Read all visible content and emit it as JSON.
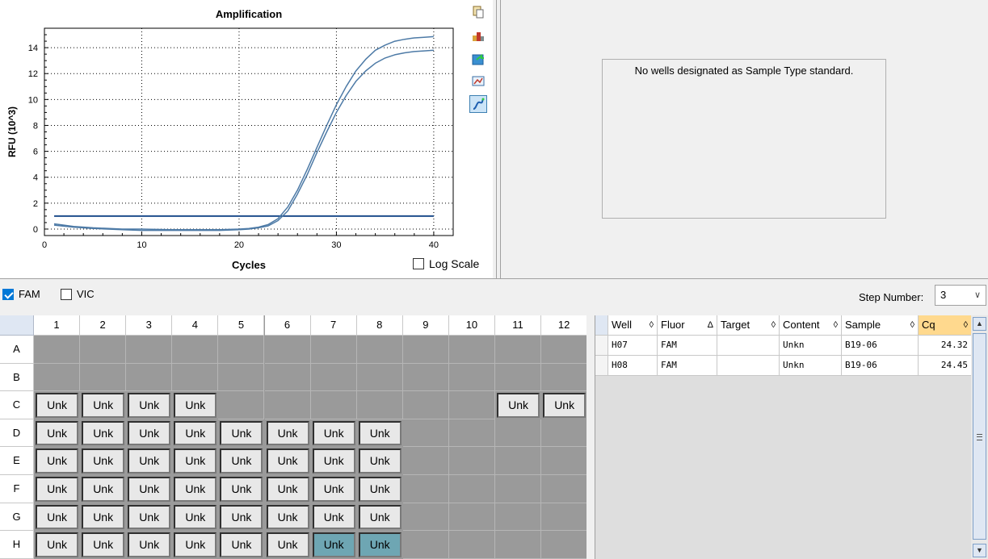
{
  "chart_data": {
    "type": "line",
    "title": "Amplification",
    "xlabel": "Cycles",
    "ylabel": "RFU (10^3)",
    "xlim": [
      0,
      42
    ],
    "ylim": [
      -0.5,
      15.5
    ],
    "x_ticks": [
      0,
      10,
      20,
      30,
      40
    ],
    "y_ticks": [
      0,
      2,
      4,
      6,
      8,
      10,
      12,
      14
    ],
    "grid": true,
    "grid_style": "dotted",
    "threshold": 1.0,
    "series": [
      {
        "x": [
          1,
          3,
          5,
          8,
          10,
          13,
          15,
          18,
          20,
          21,
          22,
          23,
          24,
          25,
          26,
          27,
          28,
          29,
          30,
          31,
          32,
          33,
          34,
          35,
          36,
          37,
          38,
          39,
          40
        ],
        "values": [
          0.4,
          0.2,
          0.1,
          0.0,
          0.0,
          -0.05,
          -0.05,
          -0.05,
          0.0,
          0.05,
          0.15,
          0.35,
          0.8,
          1.7,
          3.0,
          4.6,
          6.3,
          8.0,
          9.6,
          11.0,
          12.2,
          13.1,
          13.8,
          14.2,
          14.5,
          14.65,
          14.75,
          14.8,
          14.85
        ]
      },
      {
        "x": [
          1,
          3,
          5,
          8,
          10,
          13,
          15,
          18,
          20,
          21,
          22,
          23,
          24,
          25,
          26,
          27,
          28,
          29,
          30,
          31,
          32,
          33,
          34,
          35,
          36,
          37,
          38,
          39,
          40
        ],
        "values": [
          0.3,
          0.15,
          0.05,
          -0.05,
          -0.1,
          -0.1,
          -0.1,
          -0.1,
          -0.05,
          0.0,
          0.1,
          0.25,
          0.65,
          1.4,
          2.7,
          4.2,
          5.9,
          7.5,
          9.0,
          10.3,
          11.4,
          12.2,
          12.8,
          13.2,
          13.45,
          13.6,
          13.7,
          13.75,
          13.8
        ]
      }
    ],
    "colors": {
      "curve": "#4d7aa6",
      "threshold": "#1f4e8c"
    }
  },
  "toolbar": {
    "icons": [
      "copy-icon",
      "export-icon",
      "save-icon",
      "zoom-icon",
      "curve-icon"
    ]
  },
  "log_scale_label": "Log Scale",
  "log_scale_checked": false,
  "standard_message": "No wells designated as Sample Type standard.",
  "fluors": [
    {
      "label": "FAM",
      "checked": true
    },
    {
      "label": "VIC",
      "checked": false
    }
  ],
  "step_label": "Step Number:",
  "step_value": "3",
  "plate": {
    "columns": [
      "1",
      "2",
      "3",
      "4",
      "5",
      "6",
      "7",
      "8",
      "9",
      "10",
      "11",
      "12"
    ],
    "rows": [
      {
        "label": "A",
        "cells": [
          "",
          "",
          "",
          "",
          "",
          "",
          "",
          "",
          "",
          "",
          "",
          ""
        ]
      },
      {
        "label": "B",
        "cells": [
          "",
          "",
          "",
          "",
          "",
          "",
          "",
          "",
          "",
          "",
          "",
          ""
        ]
      },
      {
        "label": "C",
        "cells": [
          "Unk",
          "Unk",
          "Unk",
          "Unk",
          "",
          "",
          "",
          "",
          "",
          "",
          "Unk",
          "Unk"
        ]
      },
      {
        "label": "D",
        "cells": [
          "Unk",
          "Unk",
          "Unk",
          "Unk",
          "Unk",
          "Unk",
          "Unk",
          "Unk",
          "",
          "",
          "",
          ""
        ]
      },
      {
        "label": "E",
        "cells": [
          "Unk",
          "Unk",
          "Unk",
          "Unk",
          "Unk",
          "Unk",
          "Unk",
          "Unk",
          "",
          "",
          "",
          ""
        ]
      },
      {
        "label": "F",
        "cells": [
          "Unk",
          "Unk",
          "Unk",
          "Unk",
          "Unk",
          "Unk",
          "Unk",
          "Unk",
          "",
          "",
          "",
          ""
        ]
      },
      {
        "label": "G",
        "cells": [
          "Unk",
          "Unk",
          "Unk",
          "Unk",
          "Unk",
          "Unk",
          "Unk",
          "Unk",
          "",
          "",
          "",
          ""
        ]
      },
      {
        "label": "H",
        "cells": [
          "Unk",
          "Unk",
          "Unk",
          "Unk",
          "Unk",
          "Unk",
          "Unk",
          "Unk",
          "",
          "",
          "",
          ""
        ],
        "selected": [
          6,
          7
        ]
      }
    ],
    "colors": {
      "empty": "#9a9a9a",
      "well": "#e8e8e8",
      "selected": "#6ea6b3"
    }
  },
  "table": {
    "columns": [
      {
        "label": "Well",
        "sort": "◊"
      },
      {
        "label": "Fluor",
        "sort": "Δ"
      },
      {
        "label": "Target",
        "sort": "◊"
      },
      {
        "label": "Content",
        "sort": "◊"
      },
      {
        "label": "Sample",
        "sort": "◊"
      },
      {
        "label": "Cq",
        "sort": "◊"
      }
    ],
    "rows": [
      [
        "H07",
        "FAM",
        "",
        "Unkn",
        "B19-06",
        "24.32"
      ],
      [
        "H08",
        "FAM",
        "",
        "Unkn",
        "B19-06",
        "24.45"
      ]
    ]
  }
}
